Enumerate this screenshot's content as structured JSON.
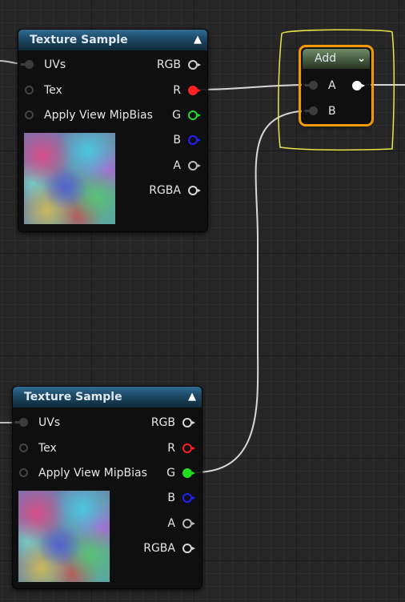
{
  "nodes": {
    "texture_sample_1": {
      "title": "Texture Sample",
      "inputs": [
        "UVs",
        "Tex",
        "Apply View MipBias"
      ],
      "outputs": [
        "RGB",
        "R",
        "G",
        "B",
        "A",
        "RGBA"
      ]
    },
    "texture_sample_2": {
      "title": "Texture Sample",
      "inputs": [
        "UVs",
        "Tex",
        "Apply View MipBias"
      ],
      "outputs": [
        "RGB",
        "R",
        "G",
        "B",
        "A",
        "RGBA"
      ]
    },
    "add": {
      "title": "Add",
      "inputs": [
        "A",
        "B"
      ]
    }
  },
  "colors": {
    "pin_white": "#d8d8d8",
    "pin_red": "#ff2020",
    "pin_green": "#22dd22",
    "pin_blue": "#2020ff",
    "selection": "#f29a00",
    "annotation": "#e6e64a"
  },
  "icons": [
    "collapse-arrow-icon",
    "chevron-down-icon"
  ]
}
